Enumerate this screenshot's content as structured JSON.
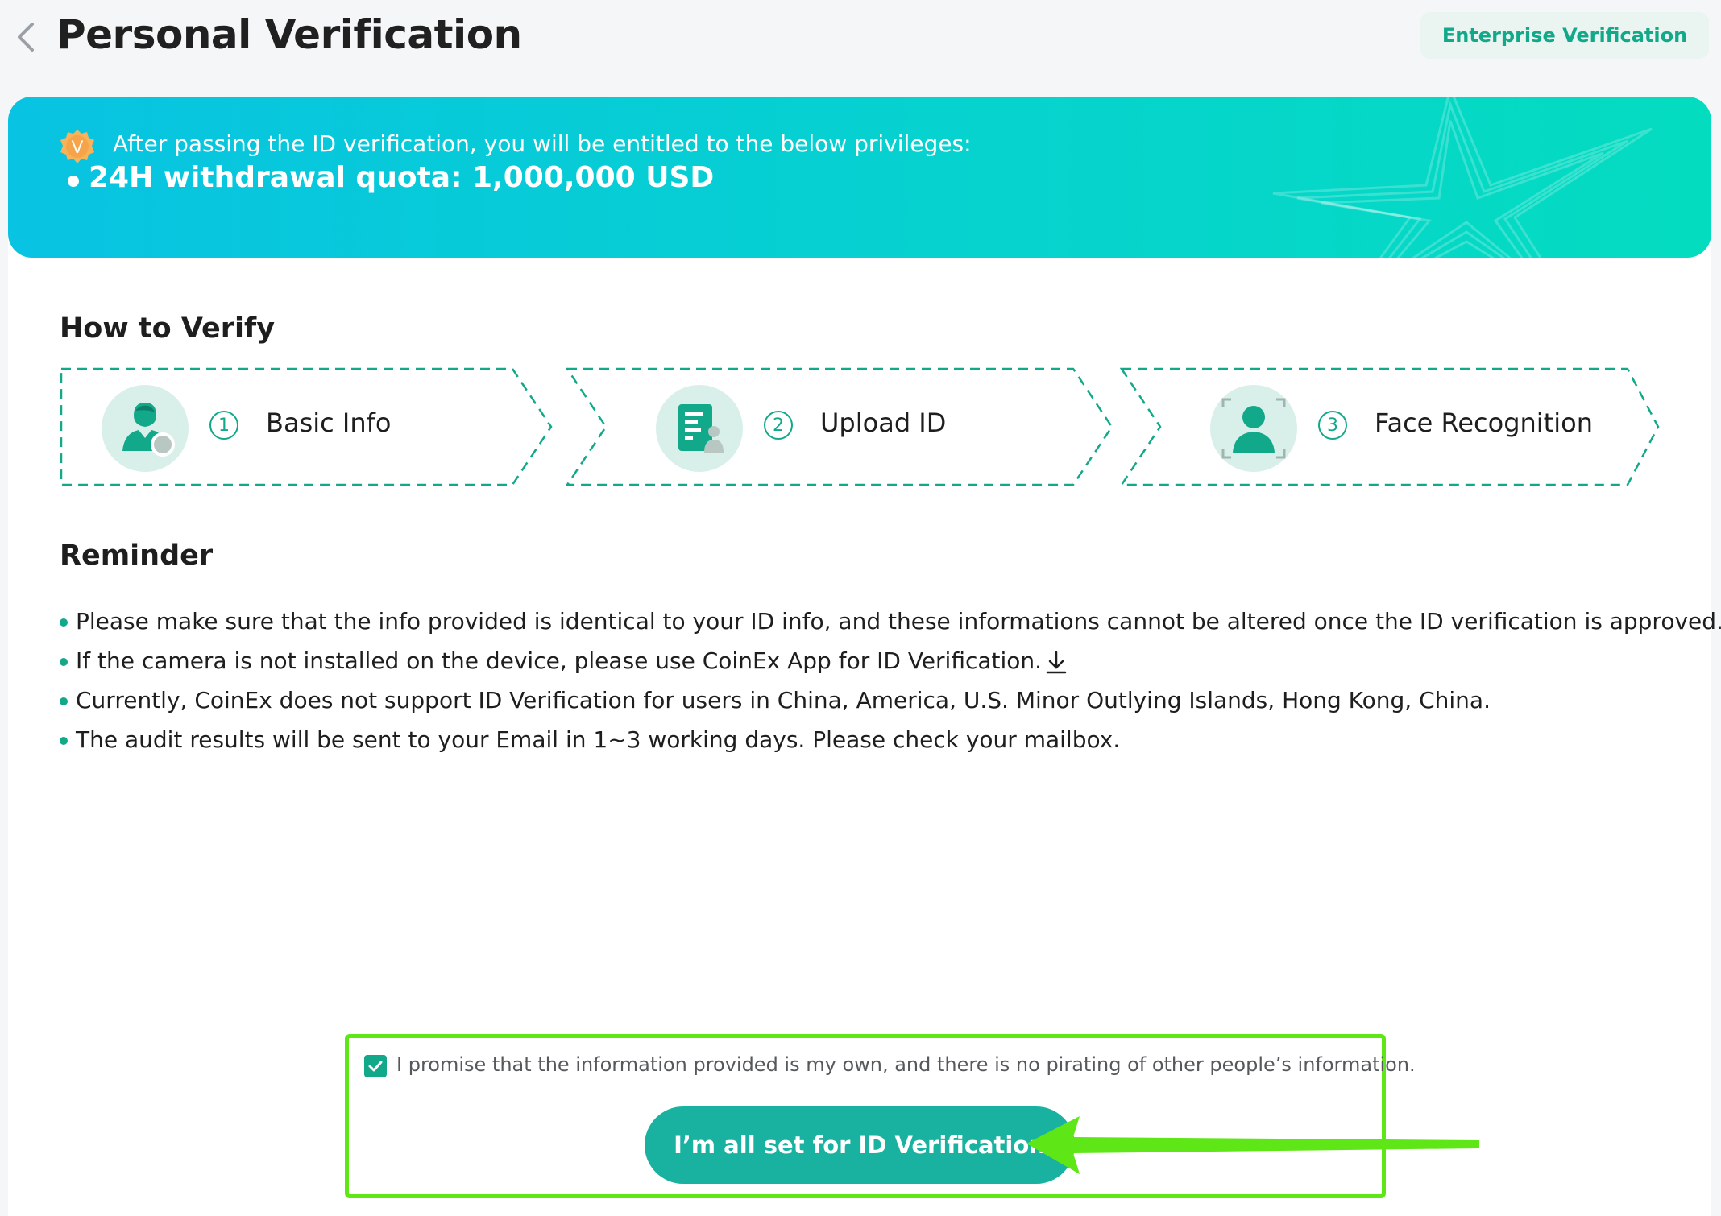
{
  "header": {
    "title": "Personal Verification",
    "enterprise_label": "Enterprise Verification"
  },
  "banner": {
    "intro": "After passing the ID verification, you will be entitled to the below privileges:",
    "badge_letter": "V",
    "quota": "24H withdrawal quota: 1,000,000 USD"
  },
  "how_to_verify": {
    "title": "How to Verify",
    "steps": [
      {
        "number": "1",
        "label": "Basic Info",
        "icon": "user-profile-icon"
      },
      {
        "number": "2",
        "label": "Upload ID",
        "icon": "id-document-icon"
      },
      {
        "number": "3",
        "label": "Face Recognition",
        "icon": "face-scan-icon"
      }
    ]
  },
  "reminder": {
    "title": "Reminder",
    "items": [
      "Please make sure that the info provided is identical to your ID info, and these informations cannot be altered once the ID verification is approved.",
      "If the camera is not installed on the device, please use CoinEx App for ID Verification.",
      "Currently, CoinEx does not support ID Verification for users in China, America, U.S. Minor Outlying Islands, Hong Kong, China.",
      "The audit results will be sent to your Email in 1~3 working days. Please check your mailbox."
    ]
  },
  "agreement": {
    "checked": true,
    "text": "I promise that the information provided is my own, and there is no pirating of other people’s information."
  },
  "submit": {
    "label": "I’m all set for ID Verification"
  },
  "colors": {
    "accent": "#12a98b",
    "button": "#19b2a0",
    "banner_start": "#08c3e2",
    "banner_end": "#04dcc0",
    "highlight": "#5ee617"
  }
}
